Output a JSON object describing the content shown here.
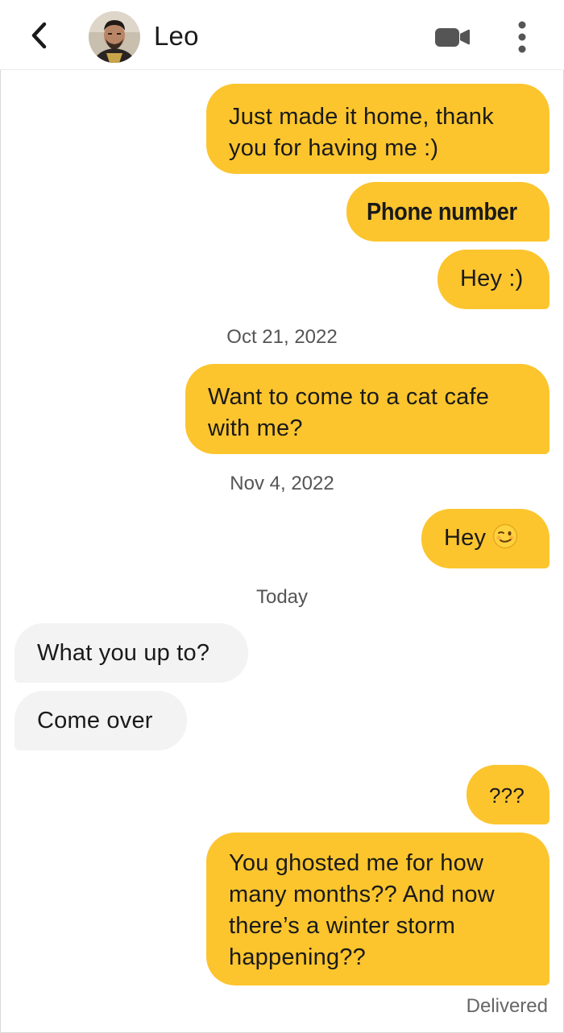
{
  "header": {
    "contact_name": "Leo",
    "icons": [
      "back-chevron-icon",
      "avatar-photo",
      "video-call-icon",
      "more-vertical-icon"
    ]
  },
  "colors": {
    "outgoing_bubble": "#fcc52e",
    "incoming_bubble": "#f3f3f3"
  },
  "messages": {
    "m1_line1": "Just made it home, thank",
    "m1_line2": "you for having me :)",
    "m2": "Phone number",
    "m3": "Hey :)",
    "date1": "Oct 21, 2022",
    "m4_line1": "Want to come to a cat cafe",
    "m4_line2": "with me?",
    "date2": "Nov 4, 2022",
    "m5": "Hey",
    "m5_emoji": "winking-face-emoji",
    "date3": "Today",
    "m6": "What you up to?",
    "m7": "Come over",
    "m8": "???",
    "m9_line1": "You ghosted me for how",
    "m9_line2": "many months?? And now",
    "m9_line3": "there’s a winter storm",
    "m9_line4": "happening??"
  },
  "status": {
    "delivered": "Delivered"
  }
}
